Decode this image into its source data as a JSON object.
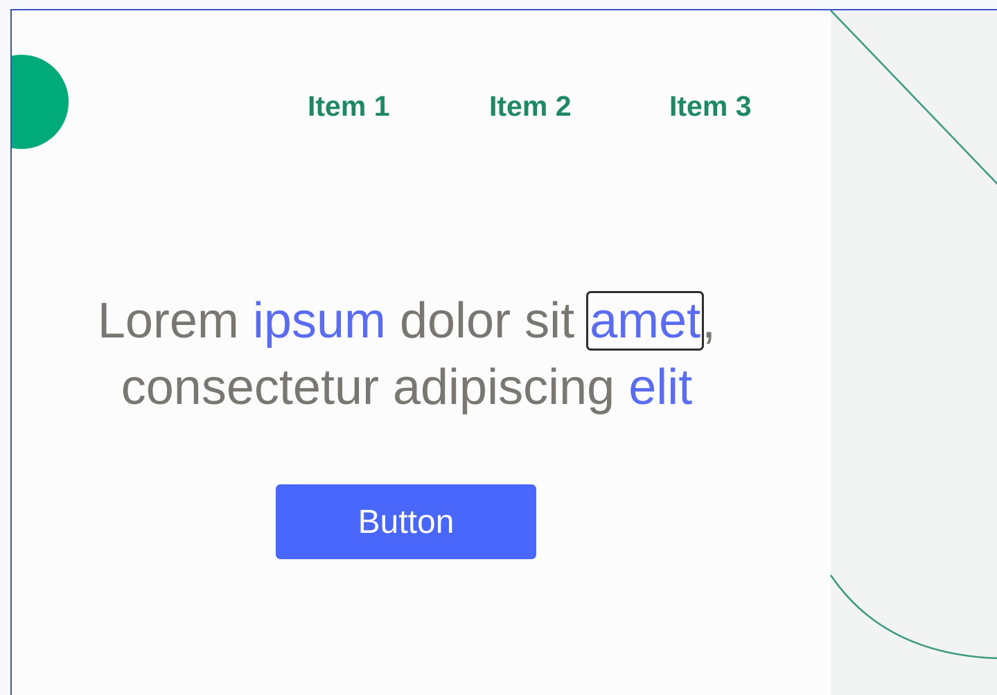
{
  "colors": {
    "frame_border": "#3a52c8",
    "accent_green": "#00ab7a",
    "nav_text": "#1d8a63",
    "body_text": "#7a7672",
    "highlight_blue": "#5a6cf2",
    "button_bg": "#4a67fb",
    "button_text": "#ffffff",
    "deco_line": "#3a9a80"
  },
  "logo": {
    "icon": "circle-logo-icon"
  },
  "nav": {
    "items": [
      {
        "label": "Item 1"
      },
      {
        "label": "Item 2"
      },
      {
        "label": "Item 3"
      }
    ]
  },
  "hero": {
    "part1": "Lorem ",
    "word_ipsum": "ipsum",
    "part2": " dolor sit ",
    "word_amet": "amet",
    "comma": ",",
    "part3": "consectetur adipiscing ",
    "word_elit": "elit"
  },
  "cta": {
    "label": "Button"
  }
}
